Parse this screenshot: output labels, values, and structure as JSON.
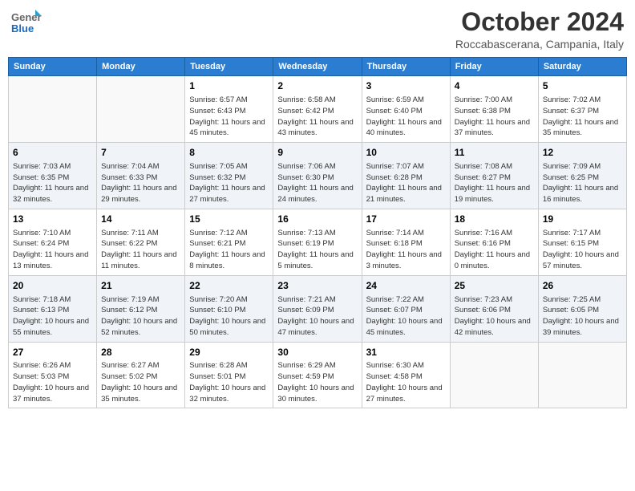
{
  "logo": {
    "general": "General",
    "blue": "Blue"
  },
  "header": {
    "month": "October 2024",
    "location": "Roccabascerana, Campania, Italy"
  },
  "weekdays": [
    "Sunday",
    "Monday",
    "Tuesday",
    "Wednesday",
    "Thursday",
    "Friday",
    "Saturday"
  ],
  "weeks": [
    [
      {
        "day": "",
        "info": ""
      },
      {
        "day": "",
        "info": ""
      },
      {
        "day": "1",
        "info": "Sunrise: 6:57 AM\nSunset: 6:43 PM\nDaylight: 11 hours and 45 minutes."
      },
      {
        "day": "2",
        "info": "Sunrise: 6:58 AM\nSunset: 6:42 PM\nDaylight: 11 hours and 43 minutes."
      },
      {
        "day": "3",
        "info": "Sunrise: 6:59 AM\nSunset: 6:40 PM\nDaylight: 11 hours and 40 minutes."
      },
      {
        "day": "4",
        "info": "Sunrise: 7:00 AM\nSunset: 6:38 PM\nDaylight: 11 hours and 37 minutes."
      },
      {
        "day": "5",
        "info": "Sunrise: 7:02 AM\nSunset: 6:37 PM\nDaylight: 11 hours and 35 minutes."
      }
    ],
    [
      {
        "day": "6",
        "info": "Sunrise: 7:03 AM\nSunset: 6:35 PM\nDaylight: 11 hours and 32 minutes."
      },
      {
        "day": "7",
        "info": "Sunrise: 7:04 AM\nSunset: 6:33 PM\nDaylight: 11 hours and 29 minutes."
      },
      {
        "day": "8",
        "info": "Sunrise: 7:05 AM\nSunset: 6:32 PM\nDaylight: 11 hours and 27 minutes."
      },
      {
        "day": "9",
        "info": "Sunrise: 7:06 AM\nSunset: 6:30 PM\nDaylight: 11 hours and 24 minutes."
      },
      {
        "day": "10",
        "info": "Sunrise: 7:07 AM\nSunset: 6:28 PM\nDaylight: 11 hours and 21 minutes."
      },
      {
        "day": "11",
        "info": "Sunrise: 7:08 AM\nSunset: 6:27 PM\nDaylight: 11 hours and 19 minutes."
      },
      {
        "day": "12",
        "info": "Sunrise: 7:09 AM\nSunset: 6:25 PM\nDaylight: 11 hours and 16 minutes."
      }
    ],
    [
      {
        "day": "13",
        "info": "Sunrise: 7:10 AM\nSunset: 6:24 PM\nDaylight: 11 hours and 13 minutes."
      },
      {
        "day": "14",
        "info": "Sunrise: 7:11 AM\nSunset: 6:22 PM\nDaylight: 11 hours and 11 minutes."
      },
      {
        "day": "15",
        "info": "Sunrise: 7:12 AM\nSunset: 6:21 PM\nDaylight: 11 hours and 8 minutes."
      },
      {
        "day": "16",
        "info": "Sunrise: 7:13 AM\nSunset: 6:19 PM\nDaylight: 11 hours and 5 minutes."
      },
      {
        "day": "17",
        "info": "Sunrise: 7:14 AM\nSunset: 6:18 PM\nDaylight: 11 hours and 3 minutes."
      },
      {
        "day": "18",
        "info": "Sunrise: 7:16 AM\nSunset: 6:16 PM\nDaylight: 11 hours and 0 minutes."
      },
      {
        "day": "19",
        "info": "Sunrise: 7:17 AM\nSunset: 6:15 PM\nDaylight: 10 hours and 57 minutes."
      }
    ],
    [
      {
        "day": "20",
        "info": "Sunrise: 7:18 AM\nSunset: 6:13 PM\nDaylight: 10 hours and 55 minutes."
      },
      {
        "day": "21",
        "info": "Sunrise: 7:19 AM\nSunset: 6:12 PM\nDaylight: 10 hours and 52 minutes."
      },
      {
        "day": "22",
        "info": "Sunrise: 7:20 AM\nSunset: 6:10 PM\nDaylight: 10 hours and 50 minutes."
      },
      {
        "day": "23",
        "info": "Sunrise: 7:21 AM\nSunset: 6:09 PM\nDaylight: 10 hours and 47 minutes."
      },
      {
        "day": "24",
        "info": "Sunrise: 7:22 AM\nSunset: 6:07 PM\nDaylight: 10 hours and 45 minutes."
      },
      {
        "day": "25",
        "info": "Sunrise: 7:23 AM\nSunset: 6:06 PM\nDaylight: 10 hours and 42 minutes."
      },
      {
        "day": "26",
        "info": "Sunrise: 7:25 AM\nSunset: 6:05 PM\nDaylight: 10 hours and 39 minutes."
      }
    ],
    [
      {
        "day": "27",
        "info": "Sunrise: 6:26 AM\nSunset: 5:03 PM\nDaylight: 10 hours and 37 minutes."
      },
      {
        "day": "28",
        "info": "Sunrise: 6:27 AM\nSunset: 5:02 PM\nDaylight: 10 hours and 35 minutes."
      },
      {
        "day": "29",
        "info": "Sunrise: 6:28 AM\nSunset: 5:01 PM\nDaylight: 10 hours and 32 minutes."
      },
      {
        "day": "30",
        "info": "Sunrise: 6:29 AM\nSunset: 4:59 PM\nDaylight: 10 hours and 30 minutes."
      },
      {
        "day": "31",
        "info": "Sunrise: 6:30 AM\nSunset: 4:58 PM\nDaylight: 10 hours and 27 minutes."
      },
      {
        "day": "",
        "info": ""
      },
      {
        "day": "",
        "info": ""
      }
    ]
  ]
}
